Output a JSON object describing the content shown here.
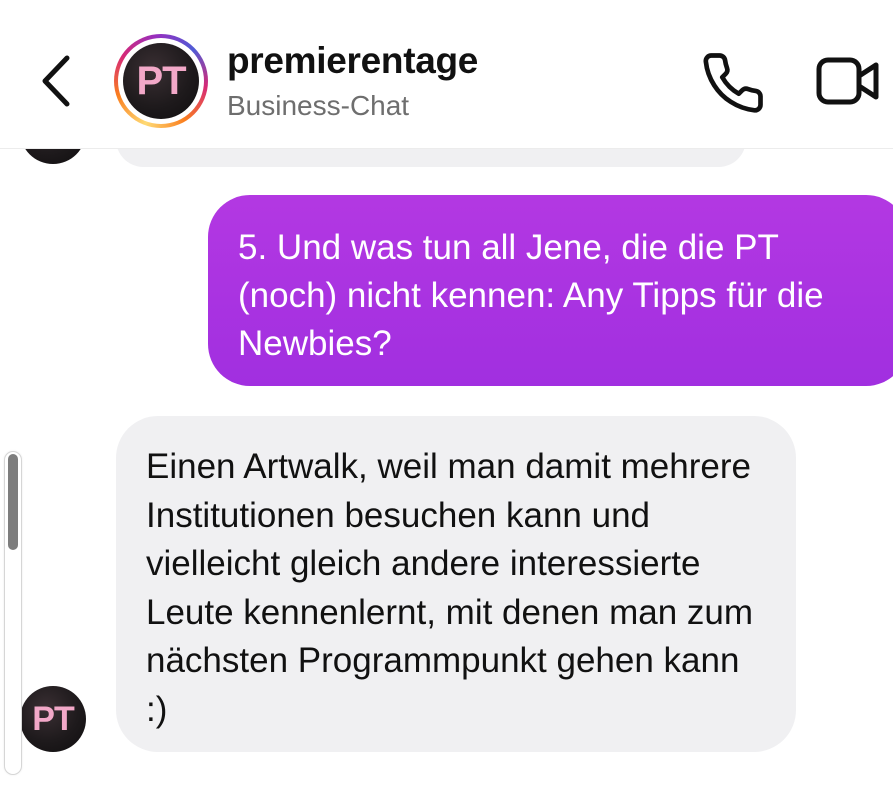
{
  "header": {
    "title": "premierentage",
    "subtitle": "Business-Chat",
    "avatar_initials": "PT",
    "icons": {
      "back": "chevron-left-icon",
      "call": "phone-icon",
      "video": "video-camera-icon"
    }
  },
  "messages": [
    {
      "direction": "outgoing",
      "text": "5.   Und was tun all Jene, die die PT (noch) nicht kennen: Any Tipps für die Newbies?"
    },
    {
      "direction": "incoming",
      "avatar_initials": "PT",
      "text": "Einen Artwalk, weil man damit mehrere Institutionen besuchen kann und vielleicht gleich andere interessierte Leute kennenlernt, mit denen man zum nächsten Programmpunkt gehen kann :)"
    }
  ],
  "colors": {
    "outgoing_bubble": "#a12fe0",
    "incoming_bubble": "#f0f0f2",
    "avatar_text": "#f2a8c8"
  }
}
